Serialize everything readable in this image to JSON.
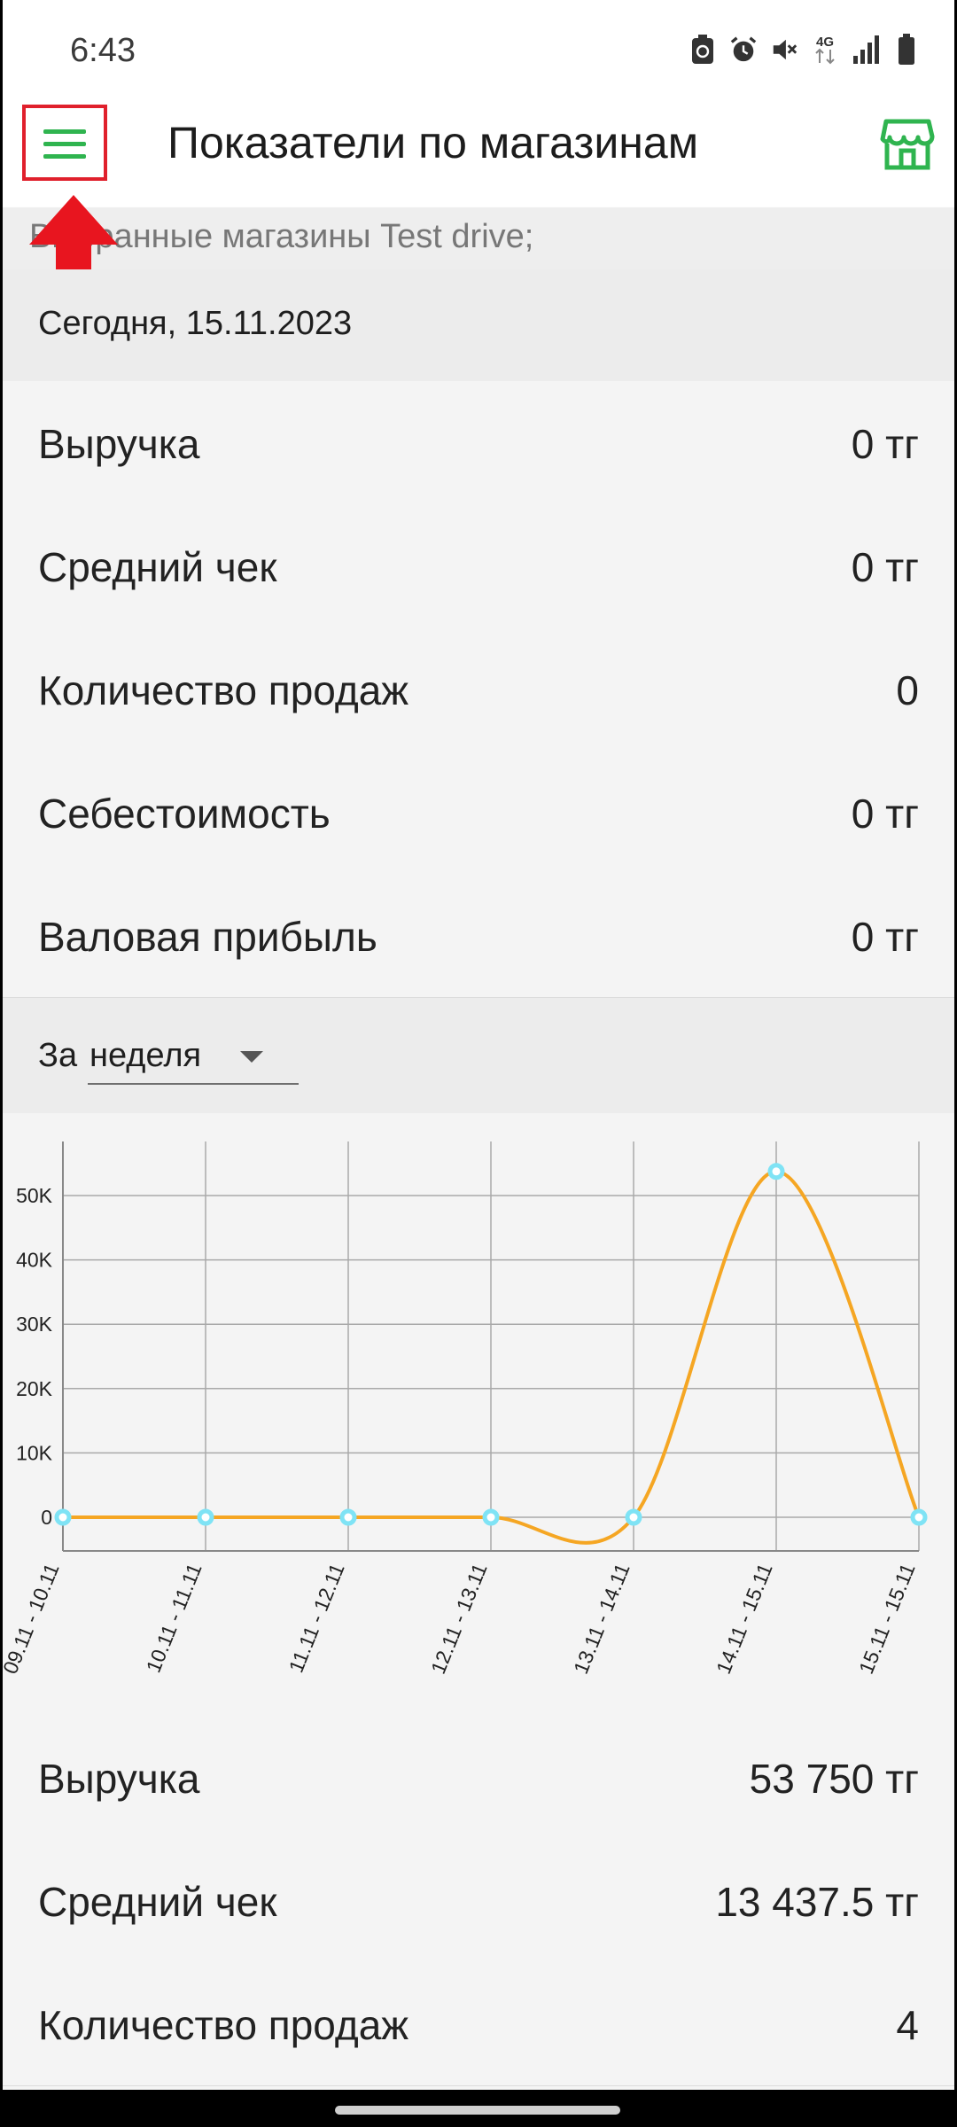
{
  "status_bar": {
    "time": "6:43",
    "icons": [
      "recycle-icon",
      "alarm-icon",
      "mute-icon",
      "4g-icon",
      "signal-icon",
      "battery-icon"
    ],
    "network_label": "4G"
  },
  "app_bar": {
    "title": "Показатели по магазинам",
    "menu_icon": "menu-icon",
    "store_icon": "store-icon",
    "accent_color": "#2fb44f"
  },
  "selected_stores": "Выбранные магазины Test drive;",
  "today": {
    "header": "Сегодня, 15.11.2023",
    "metrics": [
      {
        "label": "Выручка",
        "value": "0 тг"
      },
      {
        "label": "Средний чек",
        "value": "0 тг"
      },
      {
        "label": "Количество продаж",
        "value": "0"
      },
      {
        "label": "Себестоимость",
        "value": "0 тг"
      },
      {
        "label": "Валовая прибыль",
        "value": "0 тг"
      }
    ]
  },
  "period": {
    "prefix": "За",
    "selected": "неделя"
  },
  "chart_data": {
    "type": "line",
    "categories": [
      "09.11 - 10.11",
      "10.11 - 11.11",
      "11.11 - 12.11",
      "12.11 - 13.11",
      "13.11 - 14.11",
      "14.11 - 15.11",
      "15.11 - 15.11"
    ],
    "values": [
      0,
      0,
      0,
      0,
      0,
      53750,
      0
    ],
    "yticks": [
      0,
      10000,
      20000,
      30000,
      40000,
      50000
    ],
    "ytick_labels": [
      "0",
      "10K",
      "20K",
      "30K",
      "40K",
      "50K"
    ],
    "ylim": [
      -5000,
      58000
    ],
    "grid": true,
    "line_color": "#f5a623",
    "point_color": "#7fe3f5"
  },
  "period_metrics": [
    {
      "label": "Выручка",
      "value": "53 750 тг"
    },
    {
      "label": "Средний чек",
      "value": "13 437.5 тг"
    },
    {
      "label": "Количество продаж",
      "value": "4"
    }
  ],
  "annotation": {
    "color": "#e0202c"
  }
}
